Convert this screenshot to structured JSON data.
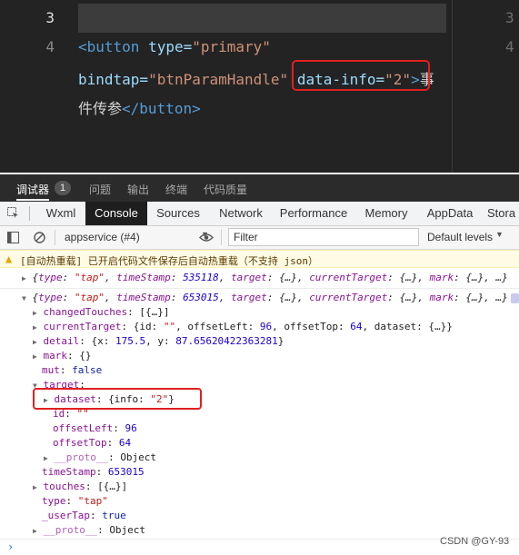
{
  "editor": {
    "line_numbers": [
      "3",
      "4"
    ],
    "right_line_numbers": [
      "3",
      "4"
    ],
    "line4_tag_open": "<button",
    "line4_attr_type": " type=",
    "line4_val_type": "\"primary\"",
    "line5_attr_bind": "bindtap=",
    "line5_val_bind": "\"btnParamHandle\"",
    "line5_attr_data": " data-info=",
    "line5_val_data": "\"2\"",
    "line5_tag_close": ">",
    "line5_text": "事",
    "line6_text": "件传参",
    "line6_tag_end": "</button>"
  },
  "panel_tabs": {
    "debugger": "调试器",
    "badge": "1",
    "issues": "问题",
    "output": "输出",
    "terminal": "终端",
    "code_quality": "代码质量"
  },
  "devtools_tabs": [
    "Wxml",
    "Console",
    "Sources",
    "Network",
    "Performance",
    "Memory",
    "AppData",
    "Stora"
  ],
  "console_toolbar": {
    "context": "appservice (#4)",
    "filter_placeholder": "Filter",
    "levels": "Default levels"
  },
  "console": {
    "warning": "[自动热重载] 已开启代码文件保存后自动热重载（不支持 json）",
    "collapsed_event": {
      "open": "{",
      "type_key": "type",
      "type_val": "\"tap\"",
      "ts_key": "timeStamp",
      "ts_val": "535118",
      "target_key": "target",
      "ct_key": "currentTarget",
      "mark_key": "mark",
      "ellipsis": "{…}",
      "tail": "…}"
    },
    "expanded_event": {
      "ts_val": "653015"
    },
    "props": {
      "changedTouches_key": "changedTouches",
      "changedTouches_val": "[{…}]",
      "currentTarget_key": "currentTarget",
      "currentTarget_val_a": "{id: ",
      "currentTarget_id": "\"\"",
      "currentTarget_val_b": ", offsetLeft: ",
      "currentTarget_left": "96",
      "currentTarget_val_c": ", offsetTop: ",
      "currentTarget_top": "64",
      "currentTarget_val_d": ", dataset: {…}}",
      "detail_key": "detail",
      "detail_a": "{x: ",
      "detail_x": "175.5",
      "detail_b": ", y: ",
      "detail_y": "87.65620422363281",
      "detail_c": "}",
      "mark_key": "mark",
      "mark_val": "{}",
      "mut_key": "mut",
      "mut_val": "false",
      "target_key": "target",
      "dataset_key": "dataset",
      "dataset_a": "{info: ",
      "dataset_info": "\"2\"",
      "dataset_c": "}",
      "id_key": "id",
      "id_val": "\"\"",
      "offsetLeft_key": "offsetLeft",
      "offsetLeft_val": "96",
      "offsetTop_key": "offsetTop",
      "offsetTop_val": "64",
      "proto_key": "__proto__",
      "proto_val": "Object",
      "timeStamp_key": "timeStamp",
      "timeStamp_val": "653015",
      "touches_key": "touches",
      "touches_val": "[{…}]",
      "type_key": "type",
      "type_val": "\"tap\"",
      "userTap_key": "_userTap",
      "userTap_val": "true"
    },
    "prompt": "›"
  },
  "watermark": "CSDN @GY-93",
  "colors": {
    "editor_bg": "#232323",
    "tag": "#569cd6",
    "attr": "#9cdcfe",
    "string": "#ce9178",
    "highlight_box": "#e02020",
    "console_key": "#881391",
    "console_string": "#c41a16",
    "console_number": "#1c00cf"
  }
}
